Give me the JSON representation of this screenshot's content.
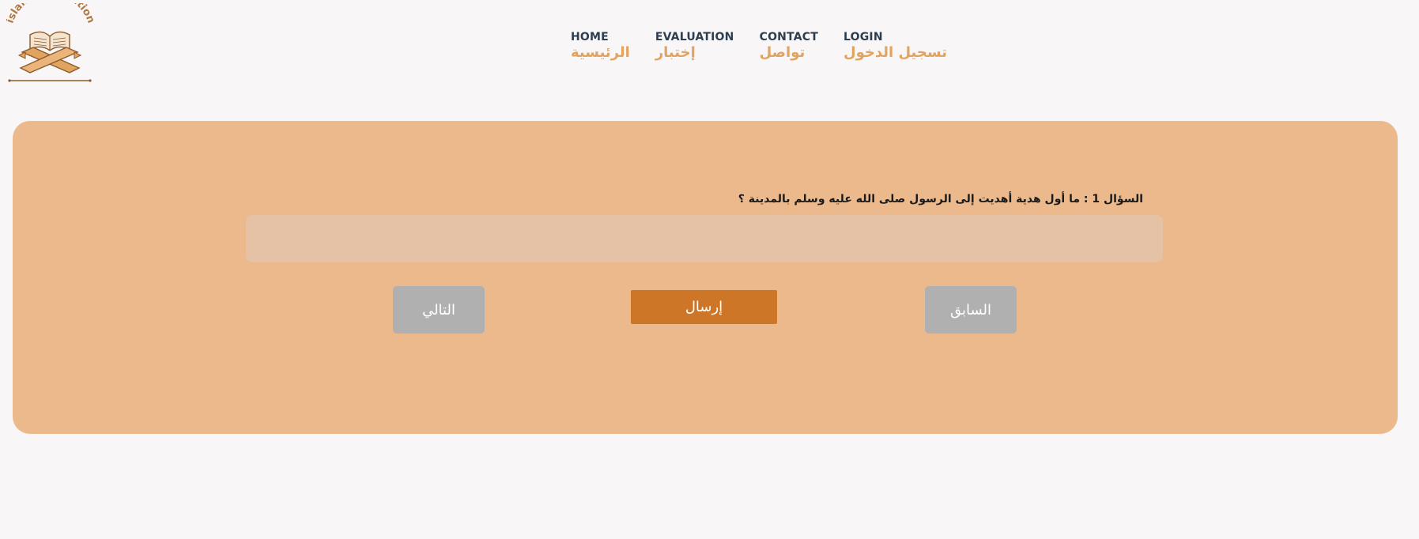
{
  "logo": {
    "text": "islamic education",
    "icon": "quran-stand-icon"
  },
  "nav": {
    "items": [
      {
        "en": "HOME",
        "ar": "الرئيسية"
      },
      {
        "en": "EVALUATION",
        "ar": "إختبار"
      },
      {
        "en": "CONTACT",
        "ar": "تواصل"
      },
      {
        "en": "LOGIN",
        "ar": "تسجيل الدخول"
      }
    ]
  },
  "quiz": {
    "question": "السؤال 1 : ما أول هدية أهديت إلى الرسول صلى الله عليه وسلم بالمدينة ؟",
    "answer_value": "",
    "next_label": "التالي",
    "submit_label": "إرسال",
    "prev_label": "السابق"
  },
  "colors": {
    "background": "#f9f6f7",
    "panel": "#ebb98c",
    "input": "#e5c2a5",
    "submit": "#cd7628",
    "nav_buttons": "#b0b0b0",
    "nav_en": "#2c3e50",
    "nav_ar": "#e0a460",
    "logo": "#b07a45"
  }
}
